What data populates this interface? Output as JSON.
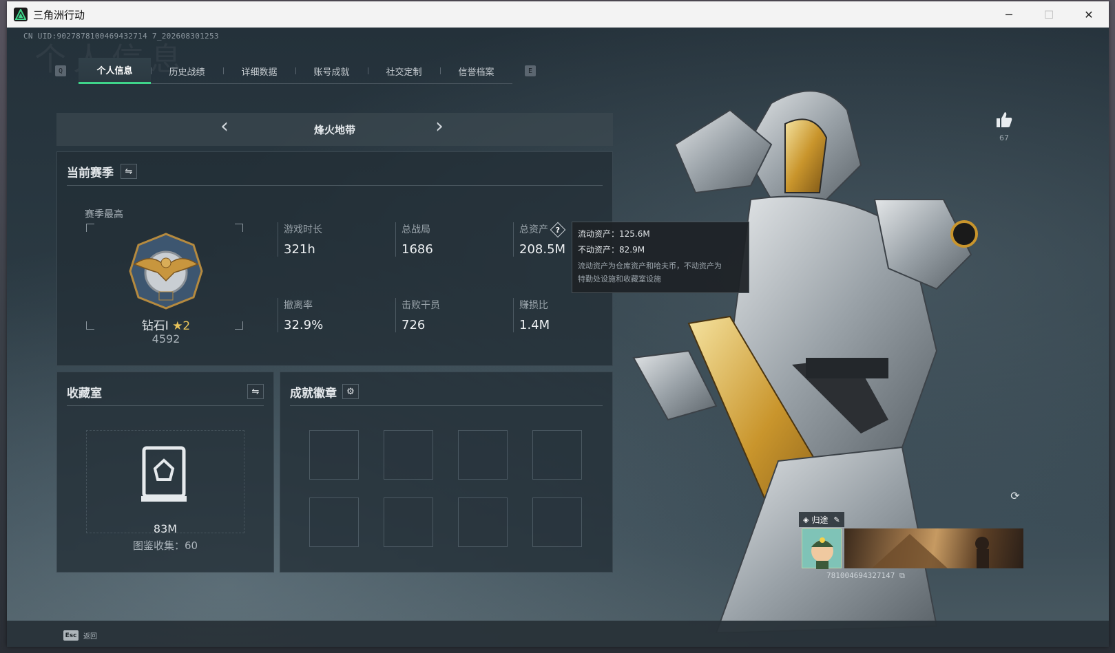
{
  "window": {
    "title": "三角洲行动",
    "controls": {
      "minimize": "─",
      "maximize": "☐",
      "close": "✕"
    }
  },
  "header": {
    "uid_text": "CN UID:9027878100469432714 7_202608301253",
    "watermark": "个人信息"
  },
  "tabs": {
    "prev_key": "Q",
    "next_key": "E",
    "items": [
      {
        "label": "个人信息",
        "active": true
      },
      {
        "label": "历史战绩",
        "active": false
      },
      {
        "label": "详细数据",
        "active": false
      },
      {
        "label": "账号成就",
        "active": false
      },
      {
        "label": "社交定制",
        "active": false
      },
      {
        "label": "信誉档案",
        "active": false
      }
    ]
  },
  "mode": {
    "title": "烽火地带",
    "prev": "‹",
    "next": "›"
  },
  "season": {
    "title": "当前赛季",
    "best_label": "赛季最高",
    "rank": "钻石Ⅰ",
    "rank_stars": "★2",
    "rank_score": "4592",
    "stats": [
      {
        "label": "游戏时长",
        "value": "321h"
      },
      {
        "label": "总战局",
        "value": "1686"
      },
      {
        "label": "总资产",
        "value": "208.5M",
        "help": "?"
      },
      {
        "label": "撤离率",
        "value": "32.9%"
      },
      {
        "label": "击败干员",
        "value": "726"
      },
      {
        "label": "赚损比",
        "value": "1.4M"
      }
    ]
  },
  "tooltip": {
    "liquid": "流动资产：125.6M",
    "fixed": "不动资产：82.9M",
    "note_1": "流动资产为仓库资产和哈夫币，不动资产为",
    "note_2": "特勤处设施和收藏室设施"
  },
  "vault": {
    "title": "收藏室",
    "value": "83M",
    "collection": "图鉴收集：60"
  },
  "badges": {
    "title": "成就徽章",
    "slots": 8
  },
  "profile": {
    "likes": "67",
    "name": "归途",
    "id_text": "781004694327147"
  },
  "footer": {
    "esc_key": "Esc",
    "esc_label": "返回"
  },
  "colors": {
    "accent": "#3fd48a",
    "panel": "#222e36",
    "title_bar": "#f3f3f3"
  }
}
